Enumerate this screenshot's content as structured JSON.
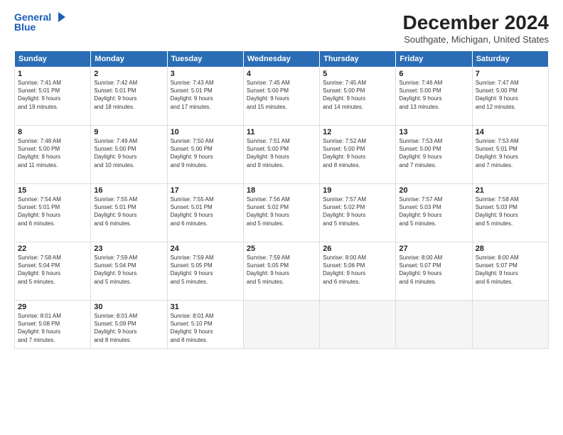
{
  "header": {
    "logo_line1": "General",
    "logo_line2": "Blue",
    "month": "December 2024",
    "location": "Southgate, Michigan, United States"
  },
  "weekdays": [
    "Sunday",
    "Monday",
    "Tuesday",
    "Wednesday",
    "Thursday",
    "Friday",
    "Saturday"
  ],
  "weeks": [
    [
      {
        "day": "1",
        "info": "Sunrise: 7:41 AM\nSunset: 5:01 PM\nDaylight: 9 hours\nand 19 minutes."
      },
      {
        "day": "2",
        "info": "Sunrise: 7:42 AM\nSunset: 5:01 PM\nDaylight: 9 hours\nand 18 minutes."
      },
      {
        "day": "3",
        "info": "Sunrise: 7:43 AM\nSunset: 5:01 PM\nDaylight: 9 hours\nand 17 minutes."
      },
      {
        "day": "4",
        "info": "Sunrise: 7:45 AM\nSunset: 5:00 PM\nDaylight: 9 hours\nand 15 minutes."
      },
      {
        "day": "5",
        "info": "Sunrise: 7:45 AM\nSunset: 5:00 PM\nDaylight: 9 hours\nand 14 minutes."
      },
      {
        "day": "6",
        "info": "Sunrise: 7:46 AM\nSunset: 5:00 PM\nDaylight: 9 hours\nand 13 minutes."
      },
      {
        "day": "7",
        "info": "Sunrise: 7:47 AM\nSunset: 5:00 PM\nDaylight: 9 hours\nand 12 minutes."
      }
    ],
    [
      {
        "day": "8",
        "info": "Sunrise: 7:48 AM\nSunset: 5:00 PM\nDaylight: 9 hours\nand 11 minutes."
      },
      {
        "day": "9",
        "info": "Sunrise: 7:49 AM\nSunset: 5:00 PM\nDaylight: 9 hours\nand 10 minutes."
      },
      {
        "day": "10",
        "info": "Sunrise: 7:50 AM\nSunset: 5:00 PM\nDaylight: 9 hours\nand 9 minutes."
      },
      {
        "day": "11",
        "info": "Sunrise: 7:51 AM\nSunset: 5:00 PM\nDaylight: 9 hours\nand 9 minutes."
      },
      {
        "day": "12",
        "info": "Sunrise: 7:52 AM\nSunset: 5:00 PM\nDaylight: 9 hours\nand 8 minutes."
      },
      {
        "day": "13",
        "info": "Sunrise: 7:53 AM\nSunset: 5:00 PM\nDaylight: 9 hours\nand 7 minutes."
      },
      {
        "day": "14",
        "info": "Sunrise: 7:53 AM\nSunset: 5:01 PM\nDaylight: 9 hours\nand 7 minutes."
      }
    ],
    [
      {
        "day": "15",
        "info": "Sunrise: 7:54 AM\nSunset: 5:01 PM\nDaylight: 9 hours\nand 6 minutes."
      },
      {
        "day": "16",
        "info": "Sunrise: 7:55 AM\nSunset: 5:01 PM\nDaylight: 9 hours\nand 6 minutes."
      },
      {
        "day": "17",
        "info": "Sunrise: 7:55 AM\nSunset: 5:01 PM\nDaylight: 9 hours\nand 6 minutes."
      },
      {
        "day": "18",
        "info": "Sunrise: 7:56 AM\nSunset: 5:02 PM\nDaylight: 9 hours\nand 5 minutes."
      },
      {
        "day": "19",
        "info": "Sunrise: 7:57 AM\nSunset: 5:02 PM\nDaylight: 9 hours\nand 5 minutes."
      },
      {
        "day": "20",
        "info": "Sunrise: 7:57 AM\nSunset: 5:03 PM\nDaylight: 9 hours\nand 5 minutes."
      },
      {
        "day": "21",
        "info": "Sunrise: 7:58 AM\nSunset: 5:03 PM\nDaylight: 9 hours\nand 5 minutes."
      }
    ],
    [
      {
        "day": "22",
        "info": "Sunrise: 7:58 AM\nSunset: 5:04 PM\nDaylight: 9 hours\nand 5 minutes."
      },
      {
        "day": "23",
        "info": "Sunrise: 7:59 AM\nSunset: 5:04 PM\nDaylight: 9 hours\nand 5 minutes."
      },
      {
        "day": "24",
        "info": "Sunrise: 7:59 AM\nSunset: 5:05 PM\nDaylight: 9 hours\nand 5 minutes."
      },
      {
        "day": "25",
        "info": "Sunrise: 7:59 AM\nSunset: 5:05 PM\nDaylight: 9 hours\nand 5 minutes."
      },
      {
        "day": "26",
        "info": "Sunrise: 8:00 AM\nSunset: 5:06 PM\nDaylight: 9 hours\nand 6 minutes."
      },
      {
        "day": "27",
        "info": "Sunrise: 8:00 AM\nSunset: 5:07 PM\nDaylight: 9 hours\nand 6 minutes."
      },
      {
        "day": "28",
        "info": "Sunrise: 8:00 AM\nSunset: 5:07 PM\nDaylight: 9 hours\nand 6 minutes."
      }
    ],
    [
      {
        "day": "29",
        "info": "Sunrise: 8:01 AM\nSunset: 5:08 PM\nDaylight: 9 hours\nand 7 minutes."
      },
      {
        "day": "30",
        "info": "Sunrise: 8:01 AM\nSunset: 5:09 PM\nDaylight: 9 hours\nand 8 minutes."
      },
      {
        "day": "31",
        "info": "Sunrise: 8:01 AM\nSunset: 5:10 PM\nDaylight: 9 hours\nand 8 minutes."
      },
      null,
      null,
      null,
      null
    ]
  ]
}
